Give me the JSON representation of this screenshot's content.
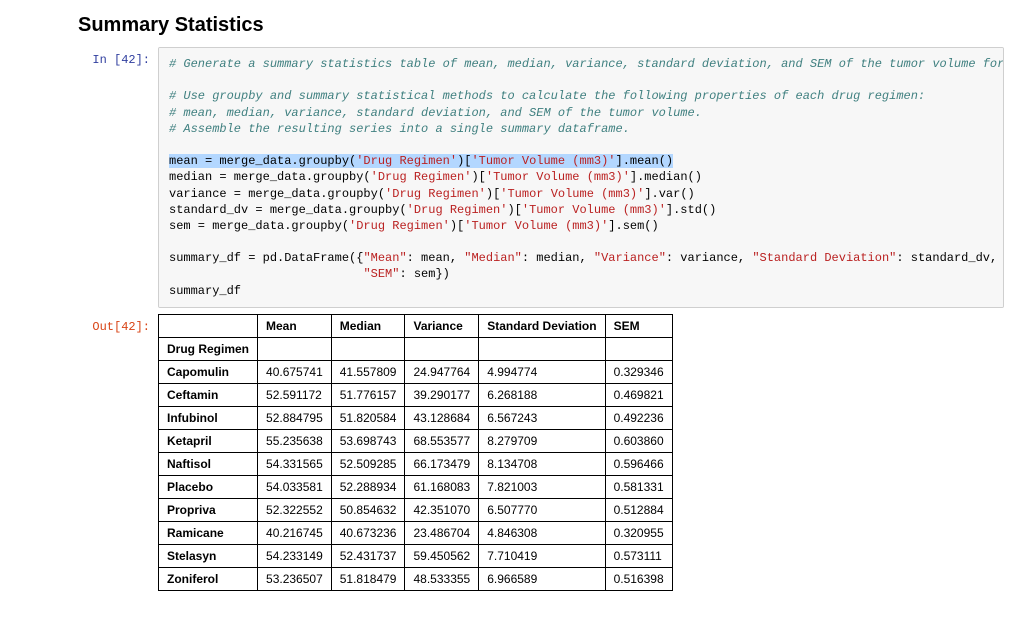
{
  "heading": "Summary Statistics",
  "prompts": {
    "in": "In [42]:",
    "out": "Out[42]:"
  },
  "code": {
    "c1": "# Generate a summary statistics table of mean, median, variance, standard deviation, and SEM of the tumor volume for each regimen",
    "c2": "# Use groupby and summary statistical methods to calculate the following properties of each drug regimen:",
    "c3": "# mean, median, variance, standard deviation, and SEM of the tumor volume.",
    "c4": "# Assemble the resulting series into a single summary dataframe.",
    "s_drug": "'Drug Regimen'",
    "s_tumor": "'Tumor Volume (mm3)'",
    "s_mean": "\"Mean\"",
    "s_median": "\"Median\"",
    "s_variance": "\"Variance\"",
    "s_std": "\"Standard Deviation\"",
    "s_sem": "\"SEM\"",
    "l_mean_a": "mean = merge_data.groupby(",
    "l_mean_b": ")[",
    "l_mean_c": "].mean()",
    "l_median_a": "median = merge_data.groupby(",
    "l_median_c": "].median()",
    "l_var_a": "variance = merge_data.groupby(",
    "l_var_c": "].var()",
    "l_std_a": "standard_dv = merge_data.groupby(",
    "l_std_c": "].std()",
    "l_sem_a": "sem = merge_data.groupby(",
    "l_sem_c": "].sem()",
    "l_df1a": "summary_df = pd.DataFrame({",
    "l_df1b": ": mean, ",
    "l_df1c": ": median, ",
    "l_df1d": ": variance, ",
    "l_df1e": ": standard_dv,",
    "l_df2a": "                           ",
    "l_df2b": ": sem})",
    "l_last": "summary_df"
  },
  "table": {
    "index_name": "Drug Regimen",
    "columns": [
      "Mean",
      "Median",
      "Variance",
      "Standard Deviation",
      "SEM"
    ],
    "rows": [
      {
        "name": "Capomulin",
        "vals": [
          "40.675741",
          "41.557809",
          "24.947764",
          "4.994774",
          "0.329346"
        ]
      },
      {
        "name": "Ceftamin",
        "vals": [
          "52.591172",
          "51.776157",
          "39.290177",
          "6.268188",
          "0.469821"
        ]
      },
      {
        "name": "Infubinol",
        "vals": [
          "52.884795",
          "51.820584",
          "43.128684",
          "6.567243",
          "0.492236"
        ]
      },
      {
        "name": "Ketapril",
        "vals": [
          "55.235638",
          "53.698743",
          "68.553577",
          "8.279709",
          "0.603860"
        ]
      },
      {
        "name": "Naftisol",
        "vals": [
          "54.331565",
          "52.509285",
          "66.173479",
          "8.134708",
          "0.596466"
        ]
      },
      {
        "name": "Placebo",
        "vals": [
          "54.033581",
          "52.288934",
          "61.168083",
          "7.821003",
          "0.581331"
        ]
      },
      {
        "name": "Propriva",
        "vals": [
          "52.322552",
          "50.854632",
          "42.351070",
          "6.507770",
          "0.512884"
        ]
      },
      {
        "name": "Ramicane",
        "vals": [
          "40.216745",
          "40.673236",
          "23.486704",
          "4.846308",
          "0.320955"
        ]
      },
      {
        "name": "Stelasyn",
        "vals": [
          "54.233149",
          "52.431737",
          "59.450562",
          "7.710419",
          "0.573111"
        ]
      },
      {
        "name": "Zoniferol",
        "vals": [
          "53.236507",
          "51.818479",
          "48.533355",
          "6.966589",
          "0.516398"
        ]
      }
    ]
  },
  "chart_data": {
    "type": "table",
    "title": "Summary Statistics",
    "index_name": "Drug Regimen",
    "columns": [
      "Mean",
      "Median",
      "Variance",
      "Standard Deviation",
      "SEM"
    ],
    "index": [
      "Capomulin",
      "Ceftamin",
      "Infubinol",
      "Ketapril",
      "Naftisol",
      "Placebo",
      "Propriva",
      "Ramicane",
      "Stelasyn",
      "Zoniferol"
    ],
    "data": [
      [
        40.675741,
        41.557809,
        24.947764,
        4.994774,
        0.329346
      ],
      [
        52.591172,
        51.776157,
        39.290177,
        6.268188,
        0.469821
      ],
      [
        52.884795,
        51.820584,
        43.128684,
        6.567243,
        0.492236
      ],
      [
        55.235638,
        53.698743,
        68.553577,
        8.279709,
        0.60386
      ],
      [
        54.331565,
        52.509285,
        66.173479,
        8.134708,
        0.596466
      ],
      [
        54.033581,
        52.288934,
        61.168083,
        7.821003,
        0.581331
      ],
      [
        52.322552,
        50.854632,
        42.35107,
        6.50777,
        0.512884
      ],
      [
        40.216745,
        40.673236,
        23.486704,
        4.846308,
        0.320955
      ],
      [
        54.233149,
        52.431737,
        59.450562,
        7.710419,
        0.573111
      ],
      [
        53.236507,
        51.818479,
        48.533355,
        6.966589,
        0.516398
      ]
    ]
  }
}
